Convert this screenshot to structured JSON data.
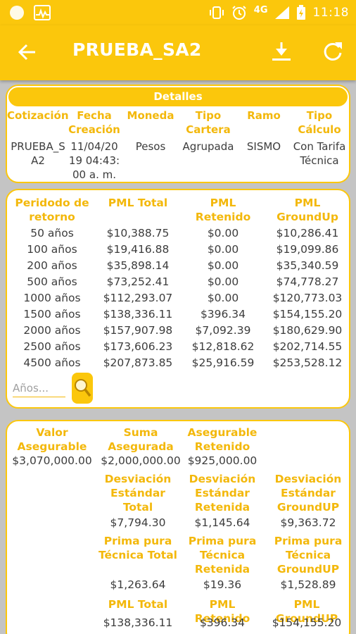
{
  "status_bar": {
    "network": "4G",
    "time": "11:18"
  },
  "app_bar": {
    "title": "PRUEBA_SA2",
    "back_icon": "arrow-back-icon",
    "download_icon": "download-icon",
    "refresh_icon": "refresh-icon"
  },
  "detalles": {
    "header": "Detalles",
    "labels": [
      "Cotización",
      "Fecha Creación",
      "Moneda",
      "Tipo Cartera",
      "Ramo",
      "Tipo Cálculo"
    ],
    "values": [
      "PRUEBA_SA2",
      "11/04/2019 04:43:00 a. m.",
      "Pesos",
      "Agrupada",
      "SISMO",
      "Con Tarifa Técnica"
    ]
  },
  "periodos": {
    "headers": [
      "Peridodo de retorno",
      "PML Total",
      "PML Retenido",
      "PML GroundUp"
    ],
    "rows": [
      [
        "50 años",
        "$10,388.75",
        "$0.00",
        "$10,286.41"
      ],
      [
        "100 años",
        "$19,416.88",
        "$0.00",
        "$19,099.86"
      ],
      [
        "200 años",
        "$35,898.14",
        "$0.00",
        "$35,340.59"
      ],
      [
        "500 años",
        "$73,252.41",
        "$0.00",
        "$74,778.27"
      ],
      [
        "1000 años",
        "$112,293.07",
        "$0.00",
        "$120,773.03"
      ],
      [
        "1500 años",
        "$138,336.11",
        "$396.34",
        "$154,155.20"
      ],
      [
        "2000 años",
        "$157,907.98",
        "$7,092.39",
        "$180,629.90"
      ],
      [
        "2500 años",
        "$173,606.23",
        "$12,818.62",
        "$202,714.55"
      ],
      [
        "4500 años",
        "$207,873.85",
        "$25,916.59",
        "$253,528.12"
      ]
    ],
    "search_placeholder": "Años...",
    "search_icon": "magnifier-icon"
  },
  "resumen": {
    "valor_asegurable_label": "Valor Asegurable",
    "valor_asegurable": "$3,070,000.00",
    "suma_asegurada_label": "Suma Asegurada",
    "suma_asegurada": "$2,000,000.00",
    "asegurable_retenido_label": "Asegurable Retenido",
    "asegurable_retenido": "$925,000.00",
    "desv_total_label": "Desviación Estándar Total",
    "desv_total": "$7,794.30",
    "desv_retenida_label": "Desviación Estándar Retenida",
    "desv_retenida": "$1,145.64",
    "desv_groundup_label": "Desviación Estándar GroundUP",
    "desv_groundup": "$9,363.72",
    "prima_total_label": "Prima pura Técnica Total",
    "prima_total": "$1,263.64",
    "prima_retenida_label": "Prima pura Técnica Retenida",
    "prima_retenida": "$19.36",
    "prima_groundup_label": "Prima pura Técnica GroundUP",
    "prima_groundup": "$1,528.89",
    "pml_total_label": "PML Total",
    "pml_total": "$138,336.11",
    "pml_retenido_label": "PML Retenido",
    "pml_retenido": "$396.34",
    "pml_groundup_label": "PML GroundUP",
    "pml_groundup": "$154,155.20"
  },
  "colors": {
    "accent": "#fbc70c",
    "label": "#f3b80b",
    "text": "#3c3c3c",
    "background": "#c4c4c4"
  }
}
